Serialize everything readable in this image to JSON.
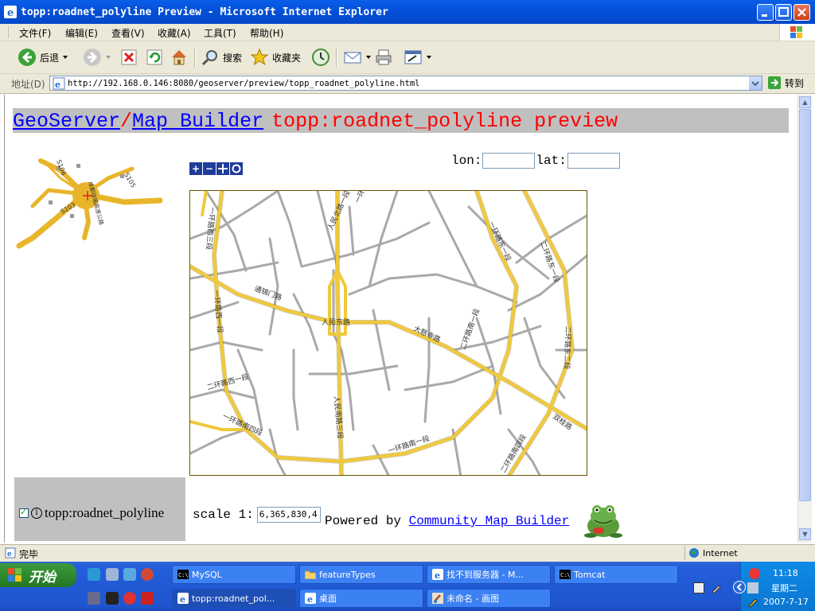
{
  "window": {
    "title": "topp:roadnet_polyline Preview - Microsoft Internet Explorer"
  },
  "menu": [
    "文件(F)",
    "编辑(E)",
    "查看(V)",
    "收藏(A)",
    "工具(T)",
    "帮助(H)"
  ],
  "toolbar": {
    "back_label": "后退",
    "search_label": "搜索",
    "favorites_label": "收藏夹"
  },
  "address": {
    "label": "地址(D)",
    "url": "http://192.168.0.146:8080/geoserver/preview/topp_roadnet_polyline.html",
    "go_label": "转到"
  },
  "page": {
    "link_geoserver": "GeoServer",
    "slash": "/",
    "link_mapbuilder": "Map Builder",
    "title": "topp:roadnet_polyline preview",
    "lon_label": "lon:",
    "lat_label": "lat:",
    "lon_value": "",
    "lat_value": "",
    "layer_name": "topp:roadnet_polyline",
    "layer_checked": true,
    "scale_label": "scale 1:",
    "scale_value": "6,365,830,4",
    "powered_text": "Powered by",
    "powered_link": "Community Map Builder"
  },
  "map_labels": {
    "overview": [
      "S106",
      "S105",
      "S103",
      "成都绕城高速公路"
    ],
    "roads": [
      "人民东路",
      "人民北路一段",
      "人民南路三段",
      "一环路东一段",
      "一环路南四段",
      "一环路南一段",
      "一环路西三段",
      "一环路西一段",
      "一环路北一段",
      "大慈寺路",
      "通锦门路",
      "双桂路",
      "二环路南四段",
      "二环路东二段",
      "二环路西一段",
      "二环路东一段",
      "二环路南一段"
    ]
  },
  "status": {
    "text": "完毕",
    "zone": "Internet"
  },
  "taskbar": {
    "start_label": "开始",
    "tasks_row1": [
      "MySQL",
      "featureTypes",
      "找不到服务器 - M...",
      "Tomcat"
    ],
    "tasks_row2": [
      "topp:roadnet_pol...",
      "桌面",
      "未命名 - 画图"
    ],
    "clock_time": "11:18",
    "clock_day": "星期二",
    "clock_date": "2007-7-17"
  },
  "colors": {
    "title_bar": "#0450d8",
    "header_bg": "#c0c0c0",
    "link": "#0000ff",
    "page_title": "#ff0000",
    "road_major": "#f0c93a",
    "road_minor": "#a9a9a9"
  }
}
